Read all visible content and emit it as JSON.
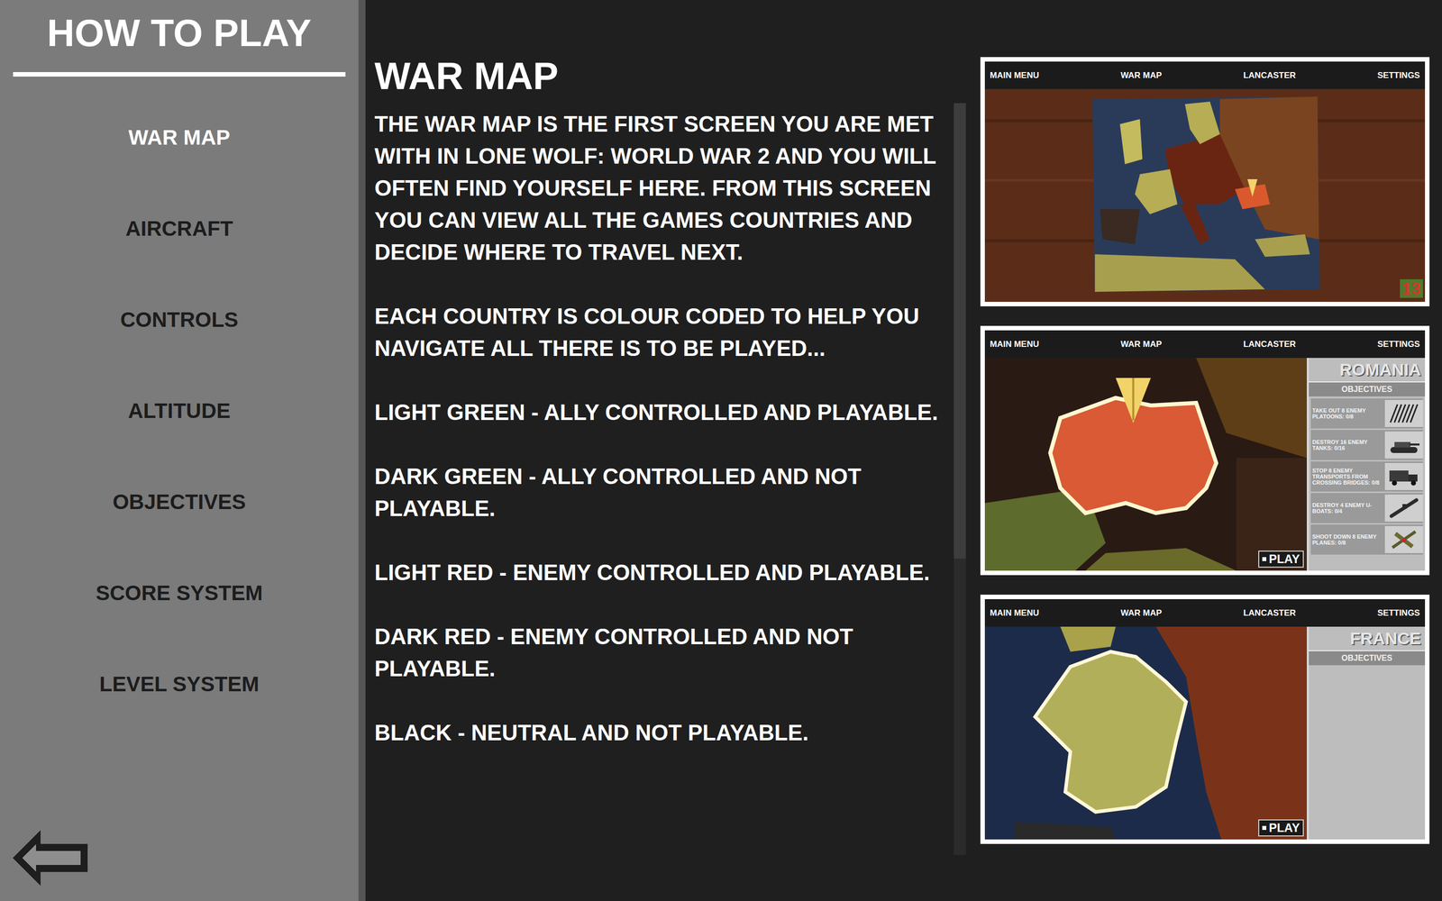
{
  "sidebar": {
    "title": "HOW TO PLAY",
    "items": [
      {
        "label": "WAR MAP",
        "selected": true
      },
      {
        "label": "AIRCRAFT",
        "selected": false
      },
      {
        "label": "CONTROLS",
        "selected": false
      },
      {
        "label": "ALTITUDE",
        "selected": false
      },
      {
        "label": "OBJECTIVES",
        "selected": false
      },
      {
        "label": "SCORE SYSTEM",
        "selected": false
      },
      {
        "label": "LEVEL SYSTEM",
        "selected": false
      }
    ]
  },
  "section": {
    "title": "WAR MAP",
    "paragraphs": [
      "THE WAR MAP IS THE FIRST SCREEN YOU ARE MET WITH IN LONE WOLF: WORLD WAR 2 AND YOU WILL OFTEN FIND YOURSELF HERE. FROM THIS SCREEN YOU CAN VIEW ALL THE GAMES COUNTRIES AND DECIDE WHERE TO TRAVEL NEXT.",
      "EACH COUNTRY IS COLOUR CODED TO HELP YOU NAVIGATE ALL THERE IS TO BE PLAYED...",
      "LIGHT GREEN - ALLY CONTROLLED AND PLAYABLE.",
      "DARK GREEN - ALLY CONTROLLED AND NOT PLAYABLE.",
      "LIGHT RED - ENEMY CONTROLLED AND PLAYABLE.",
      "DARK RED - ENEMY CONTROLLED AND NOT PLAYABLE.",
      "BLACK - NEUTRAL AND NOT PLAYABLE."
    ]
  },
  "screenshots": [
    {
      "kind": "overview",
      "nav": [
        "MAIN MENU",
        "WAR MAP",
        "LANCASTER",
        "SETTINGS"
      ],
      "badge": "13"
    },
    {
      "kind": "romania",
      "nav": [
        "MAIN MENU",
        "WAR MAP",
        "LANCASTER",
        "SETTINGS"
      ],
      "country": "ROMANIA",
      "objectives_label": "OBJECTIVES",
      "objectives": [
        {
          "text": "TAKE OUT 8 ENEMY PLATOONS: 0/8",
          "kind": "platoon"
        },
        {
          "text": "DESTROY 16 ENEMY TANKS: 0/16",
          "kind": "tank"
        },
        {
          "text": "STOP 8 ENEMY TRANSPORTS FROM CROSSING BRIDGES: 0/8",
          "kind": "truck"
        },
        {
          "text": "DESTROY 4 ENEMY U-BOATS: 0/4",
          "kind": "uboat"
        },
        {
          "text": "SHOOT DOWN 8 ENEMY PLANES: 0/8",
          "kind": "plane"
        }
      ],
      "play": "PLAY"
    },
    {
      "kind": "france",
      "nav": [
        "MAIN MENU",
        "WAR MAP",
        "LANCASTER",
        "SETTINGS"
      ],
      "country": "FRANCE",
      "objectives_label": "OBJECTIVES",
      "objectives": [],
      "play": "PLAY"
    }
  ]
}
